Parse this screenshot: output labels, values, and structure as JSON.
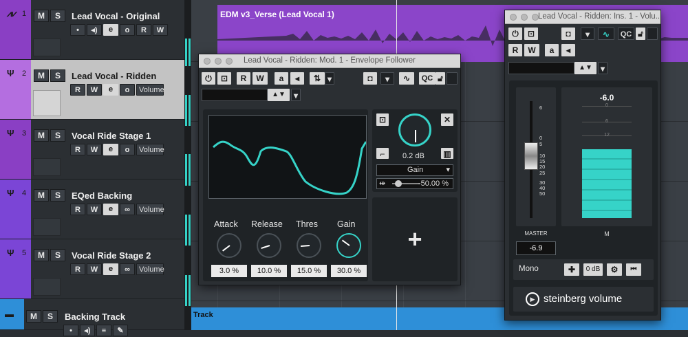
{
  "tracks": [
    {
      "number": "1",
      "name": "Lead Vocal - Original",
      "icon": "waveform-icon",
      "buttons": [
        "•",
        "◂)",
        "e",
        "o",
        "R",
        "W"
      ]
    },
    {
      "number": "2",
      "name": "Lead Vocal - Ridden",
      "icon": "fork-icon",
      "buttons": [
        "R",
        "W",
        "e",
        "o"
      ],
      "param": "Volume"
    },
    {
      "number": "3",
      "name": "Vocal Ride Stage 1",
      "icon": "fork-icon",
      "buttons": [
        "R",
        "W",
        "e",
        "o"
      ],
      "param": "Volume"
    },
    {
      "number": "4",
      "name": "EQed Backing",
      "icon": "fork-icon",
      "buttons": [
        "R",
        "W",
        "e",
        "∞"
      ],
      "param": "Volume"
    },
    {
      "number": "5",
      "name": "Vocal Ride Stage 2",
      "icon": "fork-icon",
      "buttons": [
        "R",
        "W",
        "e",
        "∞"
      ],
      "param": "Volume"
    },
    {
      "number": "",
      "name": "Backing Track",
      "icon": "folder-icon",
      "buttons": [
        "•",
        "◂)",
        "≡",
        "✎"
      ]
    }
  ],
  "mute_label": "M",
  "solo_label": "S",
  "arrangement": {
    "event_name": "EDM v3_Verse (Lead Vocal 1)",
    "backing_label": "Track"
  },
  "envelope_follower": {
    "title": "Lead Vocal - Ridden: Mod. 1 - Envelope Follower",
    "toolbar": [
      "R",
      "W",
      "a",
      "QC"
    ],
    "knobs": [
      {
        "label": "Attack",
        "value": "3.0 %",
        "level": 0.03
      },
      {
        "label": "Release",
        "value": "10.0 %",
        "level": 0.1
      },
      {
        "label": "Thres",
        "value": "15.0 %",
        "level": 0.15
      },
      {
        "label": "Gain",
        "value": "30.0 %",
        "level": 0.3
      }
    ],
    "output_db": "0.2 dB",
    "target": "Gain",
    "range_value": "-50.00 %",
    "add_symbol": "+"
  },
  "volume": {
    "title": "Lead Vocal - Ridden: Ins. 1 - Volu...",
    "toolbar": [
      "R",
      "W",
      "a",
      "QC"
    ],
    "peak": "-6.0",
    "fader_scale": [
      "6",
      "0",
      "5",
      "10",
      "15",
      "20",
      "25",
      "30",
      "40",
      "50"
    ],
    "meter_scale": [
      "0",
      "6",
      "12"
    ],
    "master_label": "MASTER",
    "master_value": "-6.9",
    "meter_label": "M",
    "mono_label": "Mono",
    "gain_button": "0 dB",
    "brand": "steinberg volume"
  },
  "colors": {
    "track_purple": "#8a3fc4",
    "event_purple": "#8b45c9",
    "meter_cyan": "#36d3c8",
    "backing_blue": "#2e8fd8"
  }
}
